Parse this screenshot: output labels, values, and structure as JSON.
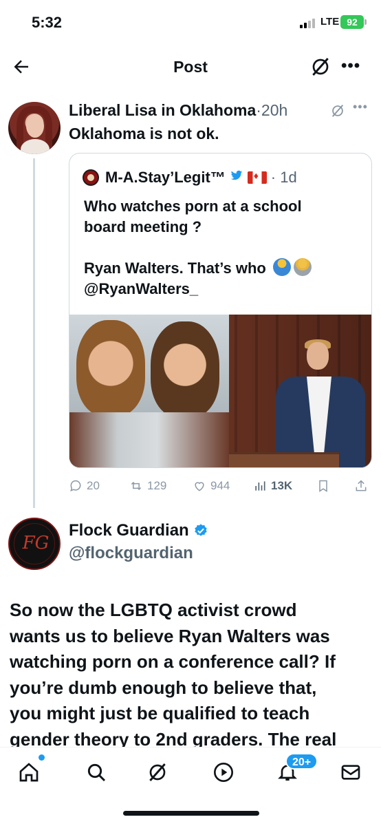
{
  "status_bar": {
    "time": "5:32",
    "network": "LTE",
    "battery": "92"
  },
  "nav": {
    "title": "Post",
    "back_icon": "arrow-left-icon",
    "grok_icon": "grok-icon",
    "more_icon": "more-horizontal-icon"
  },
  "tweet": {
    "author": "Liberal Lisa in Oklahoma",
    "separator": "·",
    "time": "20h",
    "text": "Oklahoma is not ok.",
    "quote": {
      "author": "M-A.Stay’Legit™",
      "time": "1d",
      "lines": [
        "Who watches porn at a school",
        "board meeting ?",
        "",
        "Ryan Walters. That’s who"
      ],
      "handle": "@RyanWalters_",
      "media_description_icon": "image-icon"
    },
    "stats": {
      "replies": "20",
      "reposts": "129",
      "likes": "944",
      "views": "13K"
    }
  },
  "second_post": {
    "author": "Flock Guardian",
    "handle": "@flockguardian",
    "text_lines": [
      "So now the LGBTQ activist crowd",
      "wants us to believe Ryan Walters was",
      "watching porn on a conference call? If",
      "you’re dumb enough to believe that,",
      "you might just be qualified to teach",
      "gender theory to 2nd graders. The real"
    ]
  },
  "tab_bar": {
    "badge": "20+"
  },
  "colors": {
    "accent": "#1d9bf0",
    "text": "#0f1419",
    "muted": "#536471",
    "border": "#cfd9de"
  }
}
